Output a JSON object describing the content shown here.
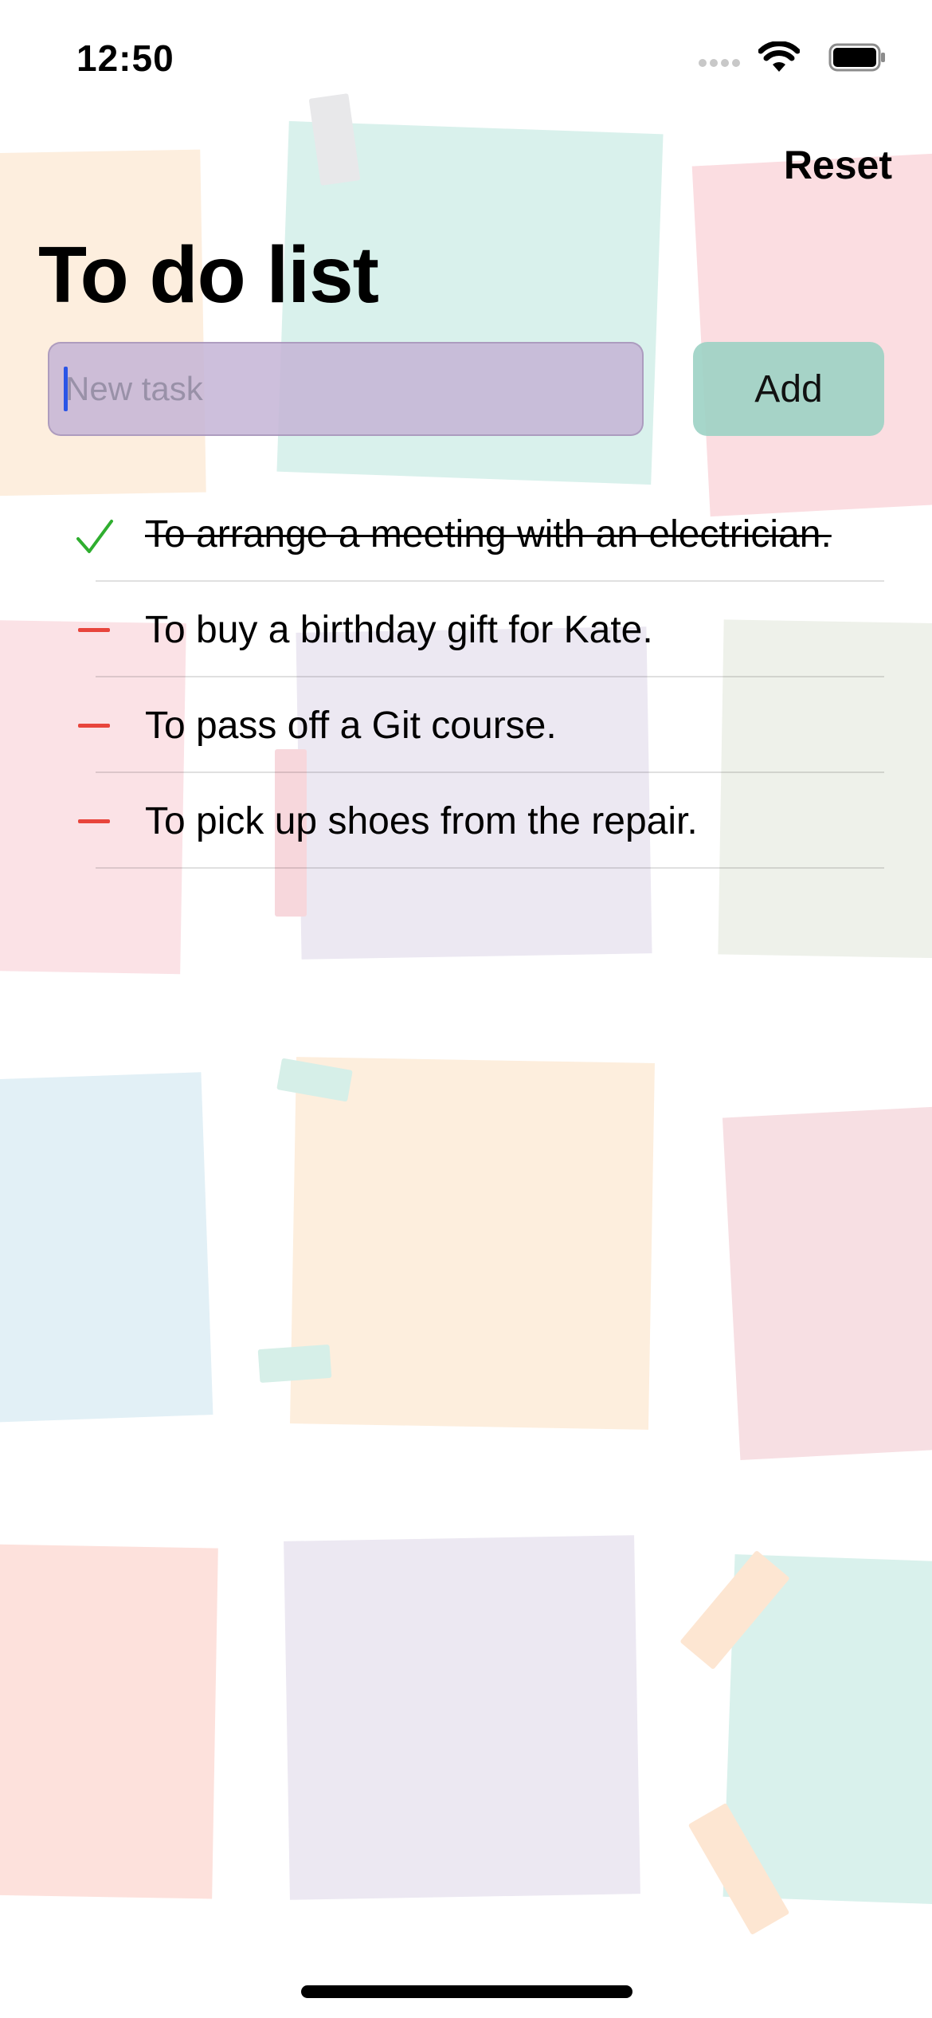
{
  "status_bar": {
    "time": "12:50",
    "icons": [
      "signal-icon",
      "wifi-icon",
      "battery-icon"
    ]
  },
  "header": {
    "reset_label": "Reset",
    "title": "To do list"
  },
  "new_task": {
    "value": "",
    "placeholder": "New task",
    "add_label": "Add"
  },
  "tasks": [
    {
      "text": "To arrange a meeting with an electrician.",
      "completed": true
    },
    {
      "text": "To buy a birthday gift for Kate.",
      "completed": false
    },
    {
      "text": "To pass off a Git course.",
      "completed": false
    },
    {
      "text": "To pick up shoes from the repair.",
      "completed": false
    }
  ],
  "colors": {
    "input_bg": "#c4b4d6",
    "add_button_bg": "#9cd2c4",
    "check_green": "#2fae2f",
    "dash_red": "#e8453c",
    "cursor_blue": "#2a55e6"
  }
}
